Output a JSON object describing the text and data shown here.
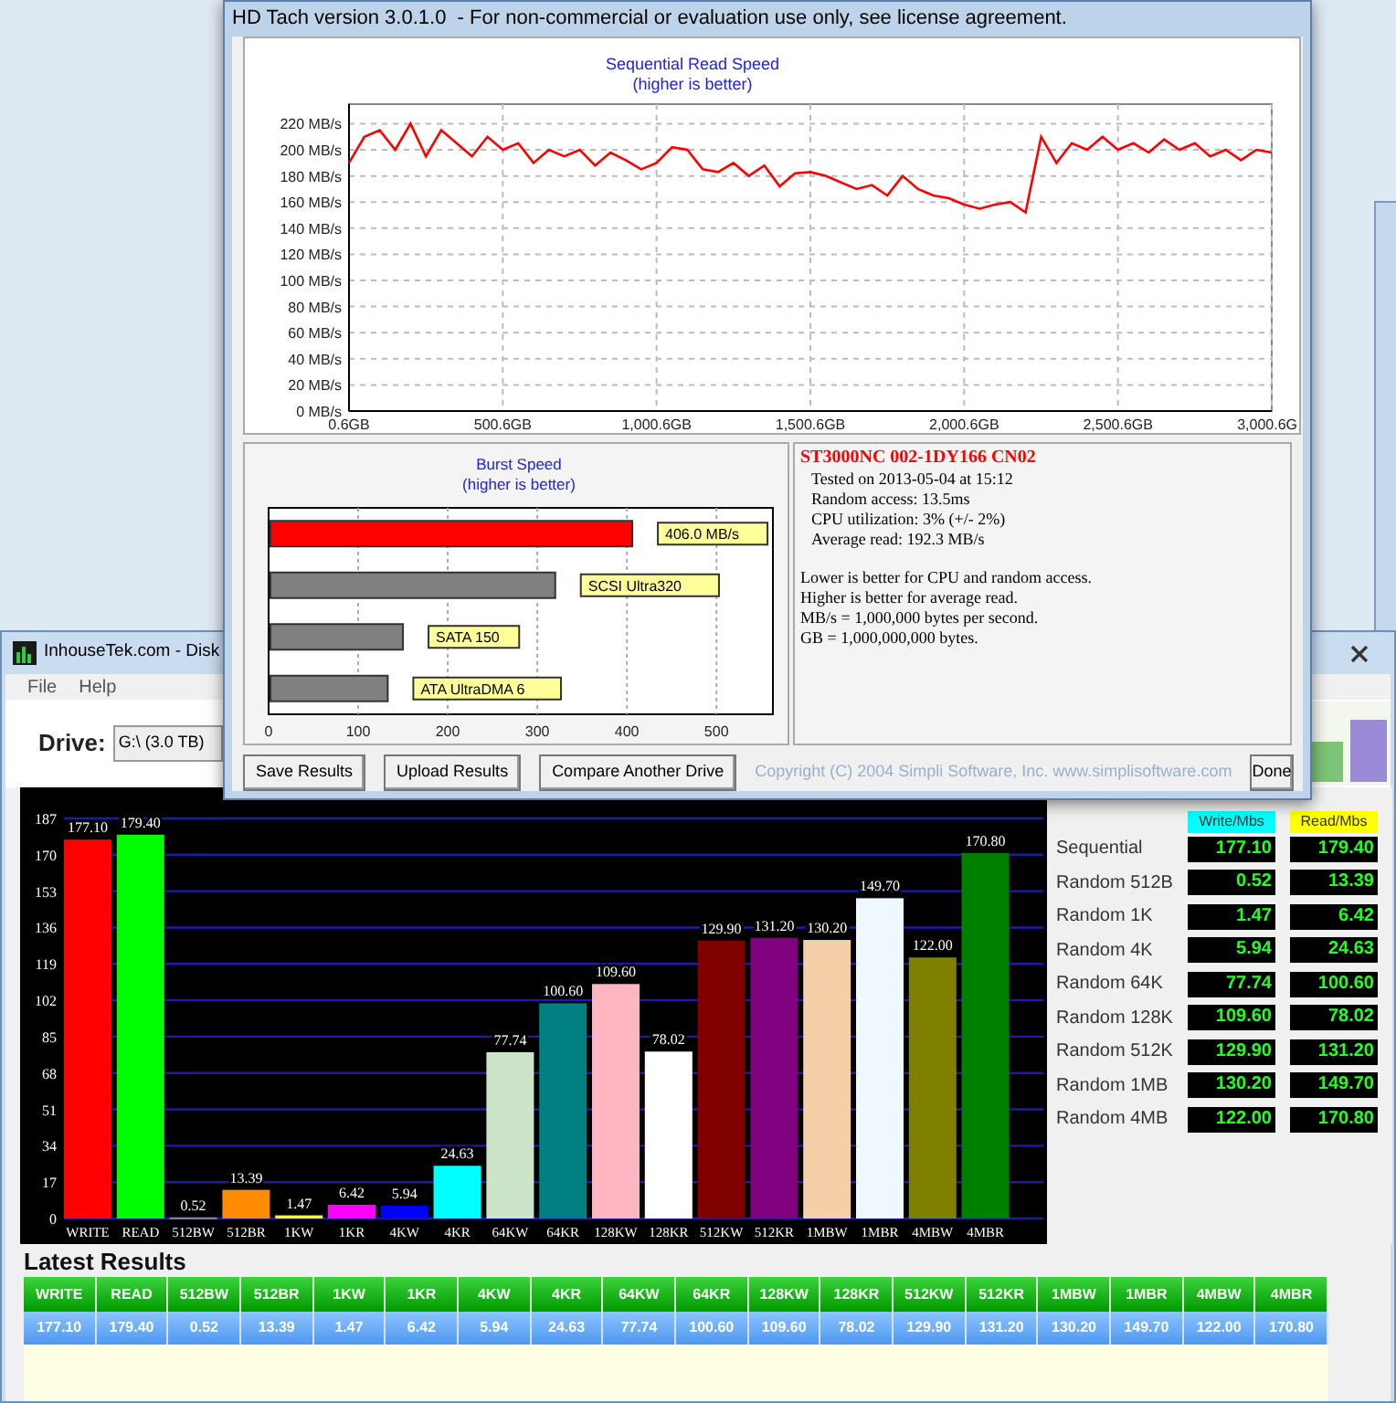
{
  "hdtach": {
    "title": "HD Tach version 3.0.1.0  - For non-commercial or evaluation use only, see license agreement.",
    "sequential": {
      "subtitle": "(higher is better)",
      "chart_data": {
        "type": "line",
        "title": "Sequential Read Speed",
        "x": [
          0.6,
          50.6,
          100.6,
          150.6,
          200.6,
          250.6,
          300.6,
          350.6,
          400.6,
          450.6,
          500.6,
          550.6,
          600.6,
          650.6,
          700.6,
          750.6,
          800.6,
          850.6,
          900.6,
          950.6,
          1000.6,
          1050.6,
          1100.6,
          1150.6,
          1200.6,
          1250.6,
          1300.6,
          1350.6,
          1400.6,
          1450.6,
          1500.6,
          1550.6,
          1600.6,
          1650.6,
          1700.6,
          1750.6,
          1800.6,
          1850.6,
          1900.6,
          1950.6,
          2000.6,
          2050.6,
          2100.6,
          2150.6,
          2200.6,
          2250.6,
          2300.6,
          2350.6,
          2400.6,
          2450.6,
          2500.6,
          2550.6,
          2600.6,
          2650.6,
          2700.6,
          2750.6,
          2800.6,
          2850.6,
          2900.6,
          2950.6,
          3000.6
        ],
        "series": [
          {
            "color": "#ff0000",
            "values": [
              190,
              210,
              215,
              200,
              220,
              195,
              215,
              205,
              195,
              210,
              200,
              205,
              190,
              200,
              195,
              200,
              188,
              198,
              192,
              185,
              190,
              202,
              200,
              185,
              183,
              190,
              180,
              188,
              172,
              182,
              183,
              180,
              175,
              170,
              173,
              165,
              180,
              170,
              165,
              163,
              158,
              155,
              158,
              160,
              152,
              210,
              190,
              205,
              200,
              210,
              200,
              205,
              198,
              208,
              200,
              205,
              195,
              200,
              192,
              200,
              198
            ]
          }
        ],
        "xlim": [
          0.6,
          3000.6
        ],
        "ylim": [
          0,
          235
        ],
        "grid": true,
        "xticks": [
          {
            "value": 0.6,
            "label": "0.6GB"
          },
          {
            "value": 500.6,
            "label": "500.6GB"
          },
          {
            "value": 1000.6,
            "label": "1,000.6GB"
          },
          {
            "value": 1500.6,
            "label": "1,500.6GB"
          },
          {
            "value": 2000.6,
            "label": "2,000.6GB"
          },
          {
            "value": 2500.6,
            "label": "2,500.6GB"
          },
          {
            "value": 3000.6,
            "label": "3,000.6G"
          }
        ],
        "yticks": [
          {
            "value": 0,
            "label": "0 MB/s"
          },
          {
            "value": 20,
            "label": "20 MB/s"
          },
          {
            "value": 40,
            "label": "40 MB/s"
          },
          {
            "value": 60,
            "label": "60 MB/s"
          },
          {
            "value": 80,
            "label": "80 MB/s"
          },
          {
            "value": 100,
            "label": "100 MB/s"
          },
          {
            "value": 120,
            "label": "120 MB/s"
          },
          {
            "value": 140,
            "label": "140 MB/s"
          },
          {
            "value": 160,
            "label": "160 MB/s"
          },
          {
            "value": 180,
            "label": "180 MB/s"
          },
          {
            "value": 200,
            "label": "200 MB/s"
          },
          {
            "value": 220,
            "label": "220 MB/s"
          }
        ]
      }
    },
    "burst": {
      "subtitle": "(higher is better)",
      "chart_data": {
        "type": "bar",
        "orientation": "horizontal",
        "title": "Burst Speed",
        "series": [
          {
            "color": "#ff0000",
            "values": [
              406,
              null,
              null,
              null
            ]
          },
          {
            "color": "#808080",
            "values": [
              null,
              320,
              150,
              133
            ]
          }
        ],
        "stacked": true,
        "xlim": [
          0,
          563
        ],
        "xticks": [
          0,
          100,
          200,
          300,
          400,
          500
        ],
        "grid": true,
        "annotations": [
          {
            "text": "406.0 MB/s",
            "x": 406
          },
          {
            "text": "SCSI Ultra320",
            "x": 320
          },
          {
            "text": "SATA 150",
            "x": 150
          },
          {
            "text": "ATA UltraDMA 6",
            "x": 133
          }
        ]
      }
    },
    "info": {
      "drive_model": "ST3000NC 002-1DY166 CN02",
      "details": [
        "Tested on 2013-05-04 at 15:12",
        "Random access: 13.5ms",
        "CPU utilization: 3% (+/- 2%)",
        "Average read: 192.3 MB/s"
      ],
      "notes": [
        "Lower is better for CPU and random access.",
        "Higher is better for average read.",
        "MB/s = 1,000,000 bytes per second.",
        "GB = 1,000,000,000 bytes."
      ]
    },
    "buttons": [
      "Save Results",
      "Upload Results",
      "Compare Another Drive"
    ],
    "copyright": "Copyright (C) 2004 Simpli Software, Inc. www.simplisoftware.com",
    "done_button": "Done"
  },
  "diskbench": {
    "title": "InhouseTek.com - Disk",
    "menu": [
      "File",
      "Help"
    ],
    "drive_label": "Drive:",
    "drive_value": "G:\\ (3.0 TB)",
    "bars": [
      {
        "color": "#ff0000"
      },
      {
        "color": "#00ff00"
      },
      {
        "color": "#909090"
      },
      {
        "color": "#ff8c00"
      },
      {
        "color": "#ffff00"
      },
      {
        "color": "#ff00ff"
      },
      {
        "color": "#0000ff"
      },
      {
        "color": "#00ffff"
      },
      {
        "color": "#cce5c8"
      },
      {
        "color": "#008080"
      },
      {
        "color": "#ffb6c1"
      },
      {
        "color": "#ffffff"
      },
      {
        "color": "#800000"
      },
      {
        "color": "#800080"
      },
      {
        "color": "#f5cfa8"
      },
      {
        "color": "#f0f8ff"
      },
      {
        "color": "#808000"
      },
      {
        "color": "#008000"
      }
    ],
    "chart_data": {
      "type": "bar",
      "categories": [
        "WRITE",
        "READ",
        "512BW",
        "512BR",
        "1KW",
        "1KR",
        "4KW",
        "4KR",
        "64KW",
        "64KR",
        "128KW",
        "128KR",
        "512KW",
        "512KR",
        "1MBW",
        "1MBR",
        "4MBW",
        "4MBR"
      ],
      "values": [
        177.1,
        179.4,
        0.52,
        13.39,
        1.47,
        6.42,
        5.94,
        24.63,
        77.74,
        100.6,
        109.6,
        78.02,
        129.9,
        131.2,
        130.2,
        149.7,
        122.0,
        170.8
      ],
      "ylim": [
        0,
        187
      ],
      "yticks": [
        0,
        17,
        34,
        51,
        68,
        85,
        102,
        119,
        136,
        153,
        170,
        187
      ],
      "grid": true,
      "value_labels": [
        "177.10",
        "179.40",
        "0.52",
        "13.39",
        "1.47",
        "6.42",
        "5.94",
        "24.63",
        "77.74",
        "100.60",
        "109.60",
        "78.02",
        "129.90",
        "131.20",
        "130.20",
        "149.70",
        "122.00",
        "170.80"
      ]
    },
    "summary": {
      "columns": [
        "Write/Mbs",
        "Read/Mbs"
      ],
      "rows": [
        {
          "label": "Sequential",
          "write": "177.10",
          "read": "179.40"
        },
        {
          "label": "Random 512B",
          "write": "0.52",
          "read": "13.39"
        },
        {
          "label": "Random 1K",
          "write": "1.47",
          "read": "6.42"
        },
        {
          "label": "Random 4K",
          "write": "5.94",
          "read": "24.63"
        },
        {
          "label": "Random 64K",
          "write": "77.74",
          "read": "100.60"
        },
        {
          "label": "Random 128K",
          "write": "109.60",
          "read": "78.02"
        },
        {
          "label": "Random 512K",
          "write": "129.90",
          "read": "131.20"
        },
        {
          "label": "Random 1MB",
          "write": "130.20",
          "read": "149.70"
        },
        {
          "label": "Random 4MB",
          "write": "122.00",
          "read": "170.80"
        }
      ]
    },
    "latest_results": {
      "title": "Latest Results",
      "columns": [
        "WRITE",
        "READ",
        "512BW",
        "512BR",
        "1KW",
        "1KR",
        "4KW",
        "4KR",
        "64KW",
        "64KR",
        "128KW",
        "128KR",
        "512KW",
        "512KR",
        "1MBW",
        "1MBR",
        "4MBW",
        "4MBR"
      ],
      "rows": [
        [
          "177.10",
          "179.40",
          "0.52",
          "13.39",
          "1.47",
          "6.42",
          "5.94",
          "24.63",
          "77.74",
          "100.60",
          "109.60",
          "78.02",
          "129.90",
          "131.20",
          "130.20",
          "149.70",
          "122.00",
          "170.80"
        ]
      ]
    }
  }
}
